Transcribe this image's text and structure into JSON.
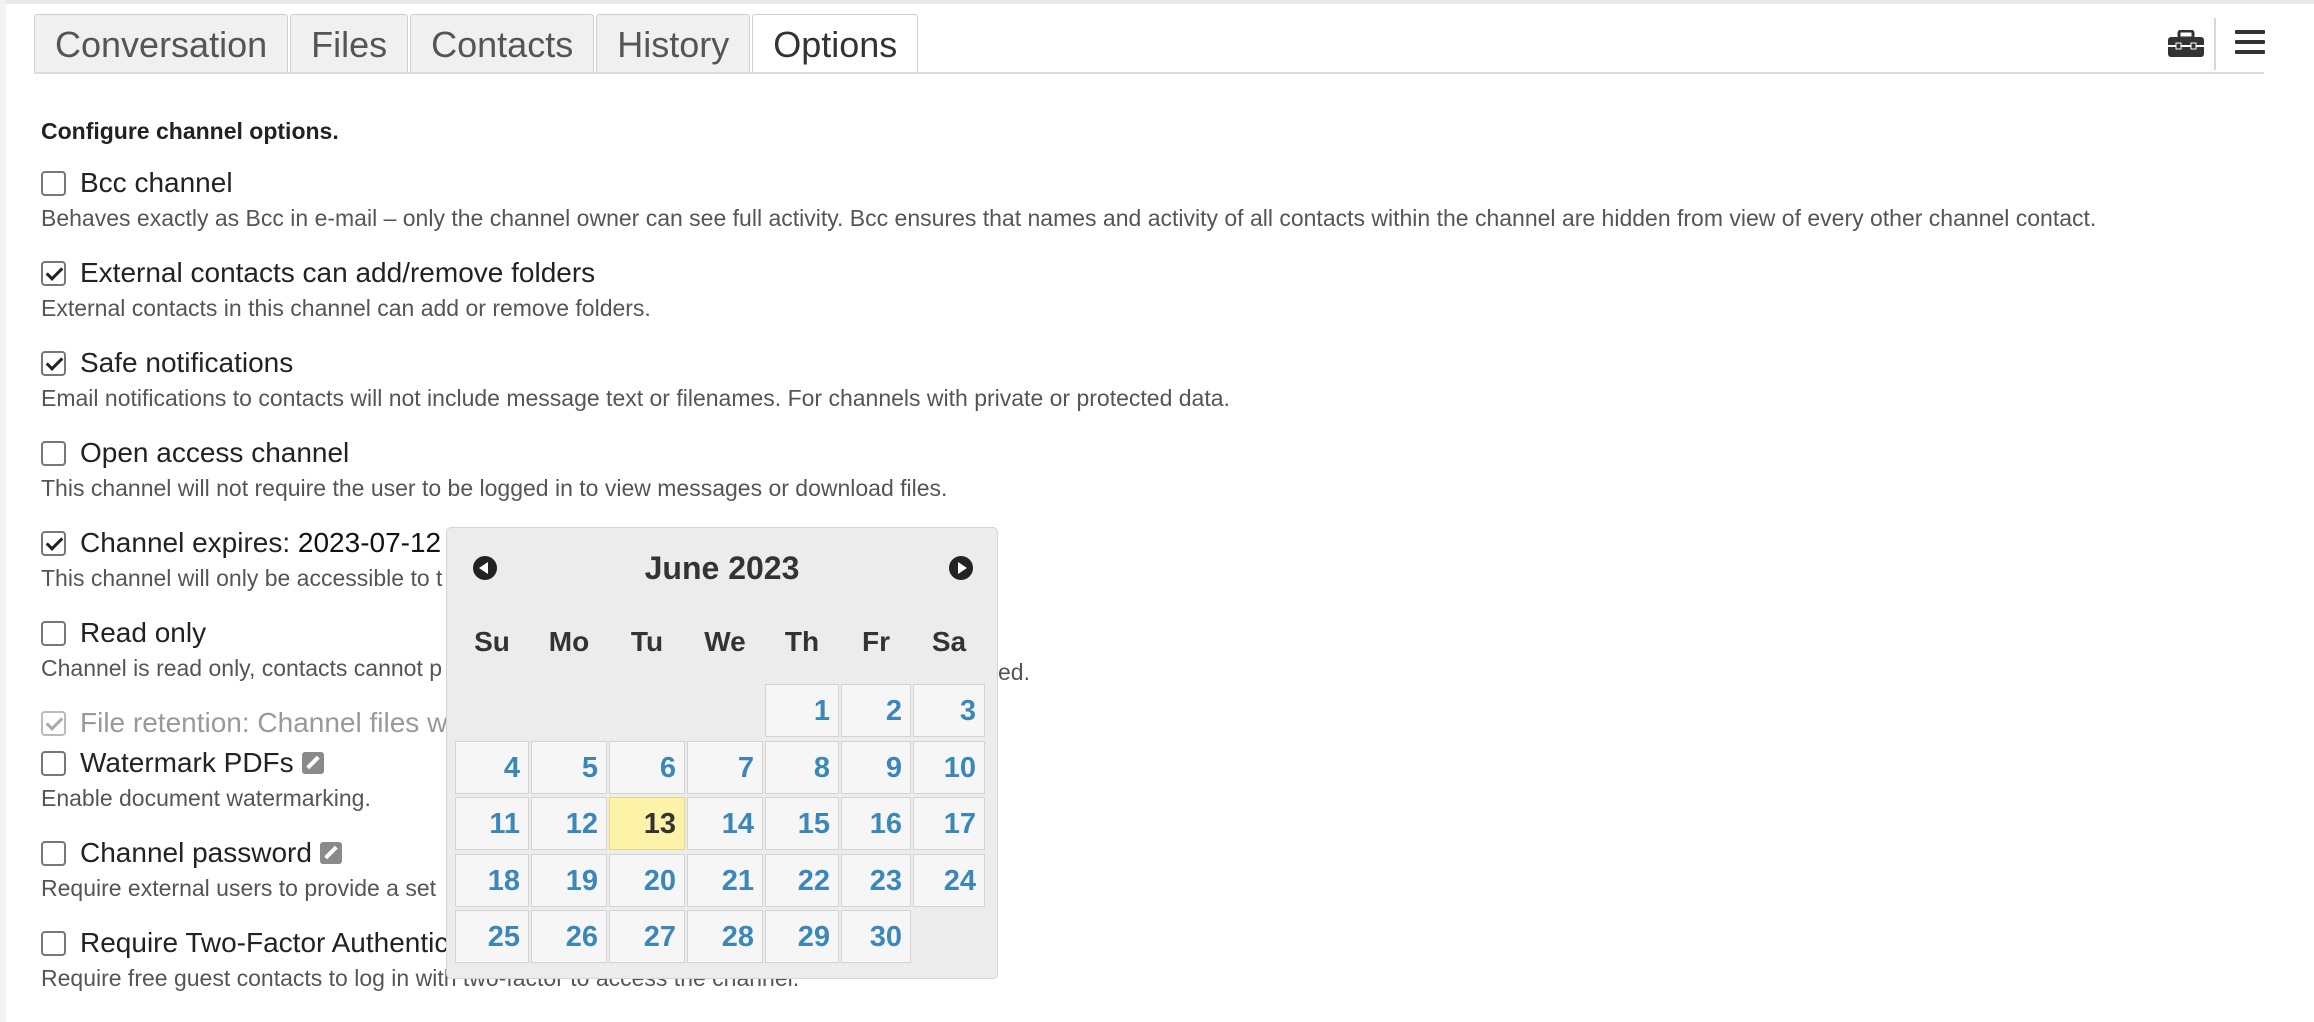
{
  "tabs": [
    "Conversation",
    "Files",
    "Contacts",
    "History",
    "Options"
  ],
  "active_tab": "Options",
  "toolbar": {
    "briefcase_icon": "briefcase-icon",
    "menu_icon": "hamburger-menu-icon"
  },
  "options": {
    "heading": "Configure channel options.",
    "items": [
      {
        "label": "Bcc channel",
        "checked": false,
        "desc": "Behaves exactly as Bcc in e-mail – only the channel owner can see full activity. Bcc ensures that names and activity of all contacts within the channel are hidden from view of every other channel contact."
      },
      {
        "label": "External contacts can add/remove folders",
        "checked": true,
        "desc": "External contacts in this channel can add or remove folders."
      },
      {
        "label": "Safe notifications",
        "checked": true,
        "desc": "Email notifications to contacts will not include message text or filenames. For channels with private or protected data."
      },
      {
        "label": "Open access channel",
        "checked": false,
        "desc": "This channel will not require the user to be logged in to view messages or download files."
      },
      {
        "label": "Channel expires: ",
        "value": "2023-07-12",
        "checked": true,
        "desc": "This channel will only be accessible to t"
      },
      {
        "label": "Read only",
        "checked": false,
        "desc": "Channel is read only, contacts cannot p",
        "desc_tail": "ed."
      },
      {
        "label": "File retention: Channel files w",
        "checked": true,
        "disabled": true
      },
      {
        "label": "Watermark PDFs",
        "checked": false,
        "has_edit_icon": true,
        "desc": "Enable document watermarking."
      },
      {
        "label": "Channel password",
        "checked": false,
        "has_edit_icon": true,
        "desc": "Require external users to provide a set"
      },
      {
        "label": "Require Two-Factor Authentica",
        "checked": false,
        "desc": "Require free guest contacts to log in with two-factor to access the channel."
      }
    ]
  },
  "datepicker": {
    "title": "June 2023",
    "prev_icon": "chevron-left-circle-icon",
    "next_icon": "chevron-right-circle-icon",
    "weekdays": [
      "Su",
      "Mo",
      "Tu",
      "We",
      "Th",
      "Fr",
      "Sa"
    ],
    "first_weekday_index": 4,
    "days_in_month": 30,
    "today": 13
  }
}
